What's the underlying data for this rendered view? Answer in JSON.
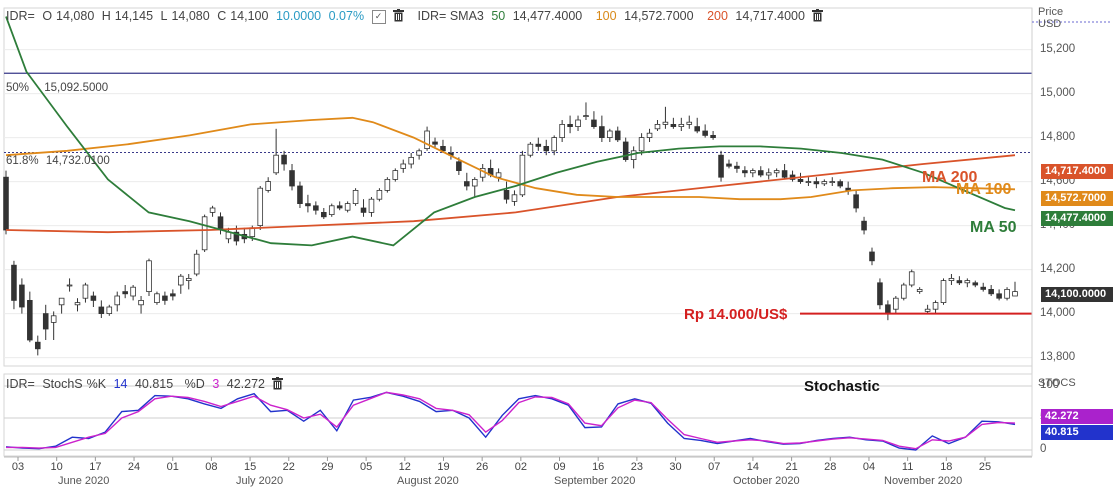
{
  "header": {
    "symbol": "IDR=",
    "open_label": "O",
    "open": "14,080",
    "high_label": "H",
    "high": "14,145",
    "low_label": "L",
    "low": "14,080",
    "close_label": "C",
    "close": "14,100",
    "change": "10.0000",
    "change_pct": "0.07%",
    "sma_label": "IDR= SMA3",
    "sma50_period": "50",
    "sma50_value": "14,477.4000",
    "sma100_period": "100",
    "sma100_value": "14,572.7000",
    "sma200_period": "200",
    "sma200_value": "14,717.4000",
    "price_axis_title": "Price",
    "price_axis_unit": "USD"
  },
  "stoch_header": {
    "symbol": "IDR=",
    "name": "StochS",
    "k_label": "%K",
    "k_period": "14",
    "k_value": "40.815",
    "d_label": "%D",
    "d_period": "3",
    "d_value": "42.272",
    "axis_title": "STOCS"
  },
  "annotations": {
    "fib_50": "50%",
    "fib_50_value": "15,092.5000",
    "fib_618": "61.8%",
    "fib_618_value": "14,732.0100",
    "ma200": "MA 200",
    "ma100": "MA 100",
    "ma50": "MA 50",
    "support": "Rp 14.000/US$",
    "stochastic": "Stochastic"
  },
  "tags": {
    "ma200": "14,717.4000",
    "ma100": "14,572.7000",
    "ma50": "14,477.4000",
    "last": "14,100.0000",
    "k": "40.815",
    "d": "42.272"
  },
  "colors": {
    "ma50": "#2e7d3a",
    "ma100": "#e08a1a",
    "ma200": "#d9532a",
    "fib": "#3a3a8a",
    "support": "#d42020",
    "k": "#2233cc",
    "d": "#cc22cc"
  },
  "chart_data": [
    {
      "type": "candlestick",
      "title": "IDR= Price (USD)",
      "ylim": [
        13780,
        15380
      ],
      "yticks": [
        "13,800",
        "14,000",
        "14,200",
        "14,400",
        "14,600",
        "14,800",
        "15,000",
        "15,200"
      ],
      "xticks": [
        "03",
        "10",
        "17",
        "24",
        "01",
        "08",
        "15",
        "22",
        "29",
        "05",
        "12",
        "19",
        "26",
        "02",
        "09",
        "16",
        "23",
        "30",
        "07",
        "14",
        "21",
        "28",
        "04",
        "11",
        "18",
        "25"
      ],
      "months": [
        "June 2020",
        "July 2020",
        "August 2020",
        "September 2020",
        "October 2020",
        "November 2020"
      ],
      "candles": [
        [
          14620,
          14650,
          14360,
          14380
        ],
        [
          14220,
          14240,
          14020,
          14060
        ],
        [
          14130,
          14160,
          14000,
          14030
        ],
        [
          14060,
          14100,
          13870,
          13880
        ],
        [
          13870,
          13900,
          13810,
          13840
        ],
        [
          14000,
          14040,
          13880,
          13930
        ],
        [
          13960,
          14010,
          13880,
          13990
        ],
        [
          14040,
          14070,
          14000,
          14070
        ],
        [
          14130,
          14160,
          14100,
          14130
        ],
        [
          14040,
          14070,
          14010,
          14050
        ],
        [
          14070,
          14140,
          14050,
          14130
        ],
        [
          14080,
          14100,
          14030,
          14060
        ],
        [
          14030,
          14060,
          13980,
          14000
        ],
        [
          14000,
          14040,
          13990,
          14030
        ],
        [
          14040,
          14100,
          14010,
          14080
        ],
        [
          14100,
          14130,
          14070,
          14090
        ],
        [
          14080,
          14130,
          14060,
          14120
        ],
        [
          14040,
          14080,
          14000,
          14060
        ],
        [
          14100,
          14250,
          14080,
          14240
        ],
        [
          14050,
          14100,
          14040,
          14090
        ],
        [
          14080,
          14100,
          14040,
          14060
        ],
        [
          14090,
          14110,
          14060,
          14080
        ],
        [
          14130,
          14180,
          14090,
          14170
        ],
        [
          14150,
          14180,
          14110,
          14160
        ],
        [
          14180,
          14290,
          14170,
          14270
        ],
        [
          14290,
          14450,
          14280,
          14440
        ],
        [
          14460,
          14490,
          14440,
          14480
        ],
        [
          14440,
          14460,
          14360,
          14380
        ],
        [
          14340,
          14390,
          14320,
          14370
        ],
        [
          14370,
          14400,
          14310,
          14330
        ],
        [
          14360,
          14390,
          14320,
          14340
        ],
        [
          14350,
          14400,
          14330,
          14390
        ],
        [
          14400,
          14580,
          14380,
          14570
        ],
        [
          14560,
          14620,
          14550,
          14600
        ],
        [
          14640,
          14840,
          14630,
          14720
        ],
        [
          14720,
          14740,
          14650,
          14680
        ],
        [
          14650,
          14680,
          14560,
          14580
        ],
        [
          14580,
          14600,
          14480,
          14500
        ],
        [
          14500,
          14540,
          14460,
          14490
        ],
        [
          14490,
          14510,
          14450,
          14470
        ],
        [
          14460,
          14480,
          14430,
          14440
        ],
        [
          14450,
          14500,
          14440,
          14490
        ],
        [
          14490,
          14510,
          14470,
          14480
        ],
        [
          14470,
          14510,
          14460,
          14500
        ],
        [
          14500,
          14570,
          14490,
          14560
        ],
        [
          14480,
          14520,
          14440,
          14460
        ],
        [
          14460,
          14530,
          14440,
          14520
        ],
        [
          14520,
          14570,
          14510,
          14560
        ],
        [
          14560,
          14620,
          14550,
          14610
        ],
        [
          14610,
          14660,
          14600,
          14650
        ],
        [
          14660,
          14700,
          14640,
          14680
        ],
        [
          14680,
          14730,
          14660,
          14710
        ],
        [
          14720,
          14750,
          14700,
          14740
        ],
        [
          14750,
          14850,
          14740,
          14830
        ],
        [
          14780,
          14800,
          14750,
          14770
        ],
        [
          14760,
          14790,
          14730,
          14740
        ],
        [
          14730,
          14760,
          14700,
          14720
        ],
        [
          14690,
          14710,
          14630,
          14650
        ],
        [
          14600,
          14640,
          14560,
          14580
        ],
        [
          14580,
          14620,
          14530,
          14610
        ],
        [
          14620,
          14680,
          14600,
          14660
        ],
        [
          14660,
          14700,
          14620,
          14630
        ],
        [
          14620,
          14660,
          14600,
          14640
        ],
        [
          14560,
          14600,
          14500,
          14520
        ],
        [
          14510,
          14560,
          14490,
          14540
        ],
        [
          14540,
          14740,
          14530,
          14720
        ],
        [
          14720,
          14780,
          14710,
          14770
        ],
        [
          14770,
          14800,
          14740,
          14760
        ],
        [
          14760,
          14790,
          14720,
          14740
        ],
        [
          14740,
          14810,
          14720,
          14800
        ],
        [
          14800,
          14880,
          14780,
          14860
        ],
        [
          14860,
          14900,
          14820,
          14850
        ],
        [
          14850,
          14900,
          14830,
          14880
        ],
        [
          14900,
          14960,
          14880,
          14900
        ],
        [
          14880,
          14920,
          14840,
          14850
        ],
        [
          14850,
          14900,
          14780,
          14800
        ],
        [
          14800,
          14840,
          14780,
          14830
        ],
        [
          14830,
          14850,
          14780,
          14790
        ],
        [
          14780,
          14800,
          14690,
          14700
        ],
        [
          14700,
          14760,
          14660,
          14740
        ],
        [
          14740,
          14820,
          14720,
          14800
        ],
        [
          14800,
          14840,
          14780,
          14820
        ],
        [
          14840,
          14880,
          14830,
          14860
        ],
        [
          14860,
          14940,
          14840,
          14870
        ],
        [
          14860,
          14890,
          14840,
          14850
        ],
        [
          14850,
          14890,
          14830,
          14860
        ],
        [
          14860,
          14900,
          14840,
          14870
        ],
        [
          14850,
          14890,
          14820,
          14830
        ],
        [
          14830,
          14860,
          14800,
          14810
        ],
        [
          14810,
          14830,
          14790,
          14800
        ],
        [
          14720,
          14740,
          14600,
          14620
        ],
        [
          14680,
          14700,
          14660,
          14670
        ],
        [
          14670,
          14690,
          14640,
          14660
        ],
        [
          14650,
          14670,
          14620,
          14640
        ],
        [
          14640,
          14660,
          14620,
          14650
        ],
        [
          14650,
          14670,
          14620,
          14630
        ],
        [
          14630,
          14660,
          14610,
          14640
        ],
        [
          14640,
          14660,
          14620,
          14650
        ],
        [
          14650,
          14680,
          14610,
          14620
        ],
        [
          14630,
          14650,
          14600,
          14610
        ],
        [
          14610,
          14640,
          14590,
          14600
        ],
        [
          14600,
          14620,
          14580,
          14600
        ],
        [
          14600,
          14620,
          14570,
          14590
        ],
        [
          14590,
          14610,
          14580,
          14600
        ],
        [
          14600,
          14620,
          14580,
          14600
        ],
        [
          14600,
          14610,
          14570,
          14580
        ],
        [
          14570,
          14600,
          14540,
          14560
        ],
        [
          14540,
          14560,
          14460,
          14480
        ],
        [
          14420,
          14440,
          14360,
          14380
        ],
        [
          14280,
          14300,
          14220,
          14240
        ],
        [
          14140,
          14160,
          14020,
          14040
        ],
        [
          14040,
          14060,
          13970,
          14000
        ],
        [
          14020,
          14080,
          14000,
          14070
        ],
        [
          14070,
          14140,
          14060,
          14130
        ],
        [
          14130,
          14200,
          14120,
          14190
        ],
        [
          14100,
          14120,
          14090,
          14110
        ],
        [
          14010,
          14040,
          14000,
          14020
        ],
        [
          14020,
          14060,
          14000,
          14050
        ],
        [
          14050,
          14160,
          14040,
          14150
        ],
        [
          14150,
          14180,
          14130,
          14160
        ],
        [
          14150,
          14170,
          14130,
          14140
        ],
        [
          14140,
          14160,
          14120,
          14150
        ],
        [
          14140,
          14150,
          14120,
          14130
        ],
        [
          14120,
          14140,
          14100,
          14110
        ],
        [
          14110,
          14130,
          14080,
          14090
        ],
        [
          14090,
          14110,
          14060,
          14070
        ],
        [
          14070,
          14120,
          14060,
          14110
        ],
        [
          14080,
          14145,
          14080,
          14100
        ]
      ],
      "ma50": [
        [
          0,
          15350
        ],
        [
          20,
          15100
        ],
        [
          60,
          14850
        ],
        [
          100,
          14610
        ],
        [
          140,
          14460
        ],
        [
          180,
          14420
        ],
        [
          220,
          14370
        ],
        [
          260,
          14320
        ],
        [
          300,
          14310
        ],
        [
          340,
          14350
        ],
        [
          380,
          14310
        ],
        [
          420,
          14460
        ],
        [
          460,
          14530
        ],
        [
          500,
          14580
        ],
        [
          540,
          14640
        ],
        [
          580,
          14690
        ],
        [
          620,
          14730
        ],
        [
          660,
          14750
        ],
        [
          700,
          14760
        ],
        [
          740,
          14760
        ],
        [
          780,
          14750
        ],
        [
          820,
          14730
        ],
        [
          860,
          14700
        ],
        [
          900,
          14640
        ],
        [
          940,
          14560
        ],
        [
          980,
          14480
        ],
        [
          990,
          14470
        ]
      ],
      "ma100": [
        [
          0,
          14720
        ],
        [
          60,
          14740
        ],
        [
          120,
          14770
        ],
        [
          180,
          14810
        ],
        [
          240,
          14860
        ],
        [
          300,
          14880
        ],
        [
          340,
          14890
        ],
        [
          360,
          14870
        ],
        [
          400,
          14800
        ],
        [
          440,
          14710
        ],
        [
          480,
          14620
        ],
        [
          520,
          14570
        ],
        [
          560,
          14540
        ],
        [
          600,
          14530
        ],
        [
          640,
          14530
        ],
        [
          680,
          14530
        ],
        [
          720,
          14520
        ],
        [
          760,
          14520
        ],
        [
          790,
          14530
        ],
        [
          830,
          14560
        ],
        [
          870,
          14570
        ],
        [
          910,
          14575
        ],
        [
          950,
          14570
        ],
        [
          990,
          14565
        ]
      ],
      "ma200": [
        [
          0,
          14380
        ],
        [
          100,
          14370
        ],
        [
          200,
          14380
        ],
        [
          300,
          14400
        ],
        [
          400,
          14420
        ],
        [
          500,
          14460
        ],
        [
          600,
          14530
        ],
        [
          700,
          14580
        ],
        [
          800,
          14630
        ],
        [
          900,
          14680
        ],
        [
          990,
          14720
        ]
      ],
      "fib_levels": [
        {
          "label": "50%",
          "value": 15092.5
        },
        {
          "label": "61.8%",
          "value": 14732.01
        }
      ],
      "support_level": 14000
    },
    {
      "type": "line",
      "title": "IDR= StochS %K 14 %D 3",
      "ylim": [
        0,
        100
      ],
      "yticks": [
        "100",
        "50",
        "0"
      ],
      "series": [
        {
          "name": "%K",
          "values": [
            5,
            3,
            2,
            6,
            20,
            18,
            28,
            60,
            62,
            85,
            84,
            80,
            72,
            65,
            80,
            88,
            60,
            62,
            45,
            62,
            30,
            78,
            82,
            90,
            84,
            76,
            60,
            62,
            50,
            20,
            54,
            80,
            85,
            80,
            70,
            35,
            36,
            72,
            80,
            73,
            42,
            18,
            15,
            10,
            14,
            18,
            13,
            9,
            10,
            15,
            18,
            20,
            16,
            14,
            3,
            0,
            22,
            10,
            20,
            45,
            44,
            40
          ]
        },
        {
          "name": "%D",
          "values": [
            4,
            4,
            3,
            4,
            12,
            20,
            26,
            50,
            60,
            80,
            84,
            82,
            76,
            68,
            76,
            84,
            70,
            63,
            50,
            56,
            36,
            70,
            80,
            90,
            86,
            80,
            65,
            62,
            55,
            28,
            46,
            74,
            83,
            82,
            72,
            42,
            38,
            66,
            78,
            74,
            48,
            24,
            18,
            12,
            14,
            16,
            14,
            10,
            11,
            14,
            17,
            19,
            17,
            15,
            6,
            2,
            16,
            14,
            20,
            40,
            43,
            42
          ]
        }
      ]
    }
  ]
}
